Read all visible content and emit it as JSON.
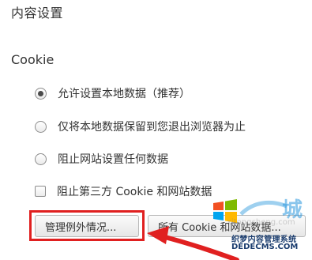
{
  "page": {
    "title": "内容设置"
  },
  "cookie": {
    "section_label": "Cookie",
    "options": [
      {
        "label": "允许设置本地数据（推荐）",
        "type": "radio",
        "checked": true
      },
      {
        "label": "仅将本地数据保留到您退出浏览器为止",
        "type": "radio",
        "checked": false
      },
      {
        "label": "阻止网站设置任何数据",
        "type": "radio",
        "checked": false
      },
      {
        "label": "阻止第三方 Cookie 和网站数据",
        "type": "checkbox",
        "checked": false
      }
    ],
    "buttons": {
      "manage_exceptions": "管理例外情况...",
      "all_cookies": "所有 Cookie 和网站数据..."
    }
  },
  "annotation": {
    "highlight_color": "#e02020"
  },
  "watermark": {
    "site_name": "织梦内容管理系统",
    "url": "DEDECMS.COM",
    "faint_text": "xitongcheng.com",
    "brand_char": "城"
  }
}
